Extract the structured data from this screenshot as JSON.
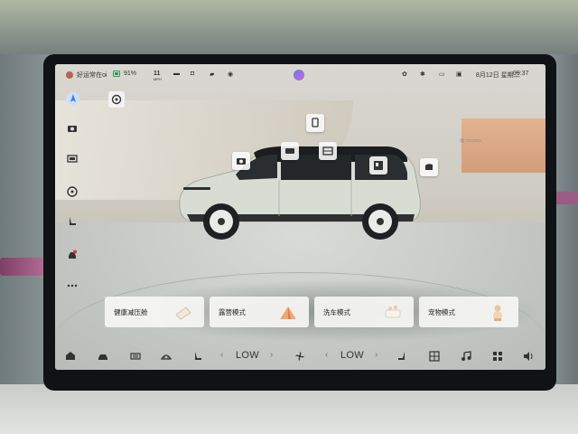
{
  "status_bar": {
    "greeting": "好运常在oi",
    "battery": "91%",
    "temp_value": "11",
    "temp_unit": "MPH",
    "date": "8月12日 星期二",
    "time": "09:37"
  },
  "modes": [
    {
      "label": "健康减压舱",
      "icon": "wellness-pillow-icon"
    },
    {
      "label": "露营模式",
      "icon": "camping-tent-icon"
    },
    {
      "label": "洗车模式",
      "icon": "car-wash-icon"
    },
    {
      "label": "宠物模式",
      "icon": "pet-dog-icon"
    }
  ],
  "dock": {
    "fan_left": "LOW",
    "fan_right": "LOW",
    "chevron_left": "‹",
    "chevron_right": "›"
  },
  "colors": {
    "car_body": "#d7ddd3",
    "car_roof": "#1b1d1f",
    "accent": "#d8a07e"
  }
}
